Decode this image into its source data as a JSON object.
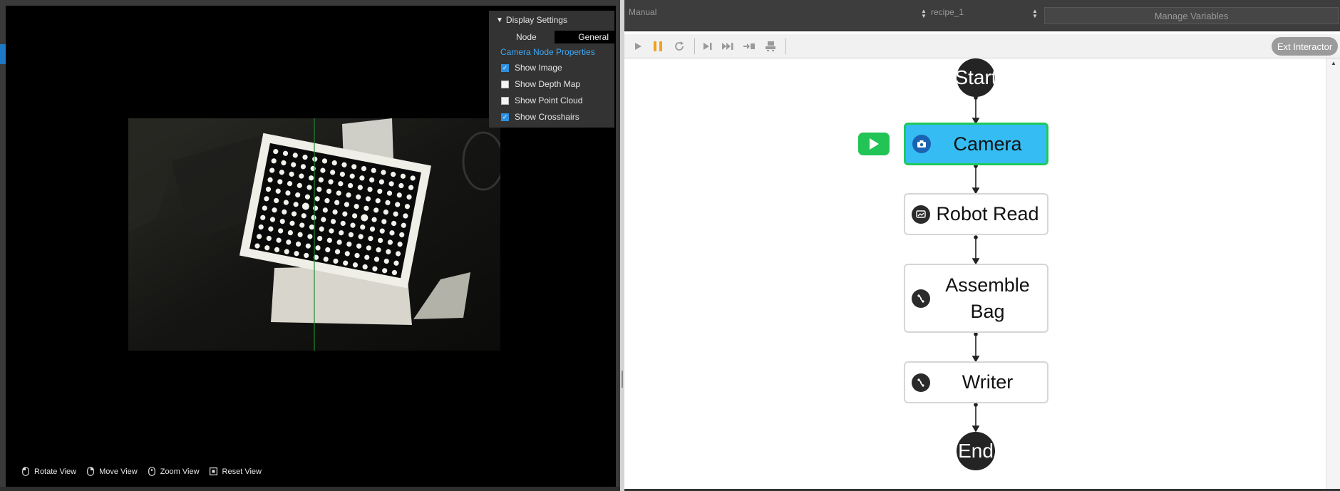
{
  "viewport": {
    "display_settings": {
      "title": "Display Settings",
      "node_label": "Node",
      "node_value": "General",
      "properties_link": "Camera Node Properties",
      "options": [
        {
          "label": "Show Image",
          "checked": true
        },
        {
          "label": "Show Depth Map",
          "checked": false
        },
        {
          "label": "Show Point Cloud",
          "checked": false
        },
        {
          "label": "Show Crosshairs",
          "checked": true
        }
      ]
    },
    "view_controls": [
      {
        "label": "Rotate View",
        "icon": "mouse-left-icon"
      },
      {
        "label": "Move View",
        "icon": "mouse-right-icon"
      },
      {
        "label": "Zoom View",
        "icon": "mouse-wheel-icon"
      },
      {
        "label": "Reset View",
        "icon": "reset-view-icon"
      }
    ]
  },
  "topbar": {
    "mode": "Manual",
    "recipe": "recipe_1",
    "manage_variables": "Manage Variables"
  },
  "toolbar": {
    "buttons": [
      "play-icon",
      "pause-icon",
      "restart-icon",
      "step-icon",
      "skip-end-icon",
      "step-into-icon",
      "robot-icon"
    ],
    "ext_interactor": "Ext Interactor"
  },
  "flow": {
    "start": "Start",
    "end": "End",
    "nodes": [
      {
        "label": "Camera",
        "icon": "camera-icon",
        "active": true
      },
      {
        "label": "Robot Read",
        "icon": "robot-read-icon",
        "active": false
      },
      {
        "label": "Assemble Bag",
        "icon": "link-icon",
        "active": false
      },
      {
        "label": "Writer",
        "icon": "link-icon",
        "active": false
      }
    ]
  },
  "colors": {
    "active_node_fill": "#35bdf3",
    "active_node_border": "#1fc95c",
    "run_indicator": "#21c455",
    "link_accent": "#3fa9f5",
    "pause_icon": "#f0a21c"
  }
}
